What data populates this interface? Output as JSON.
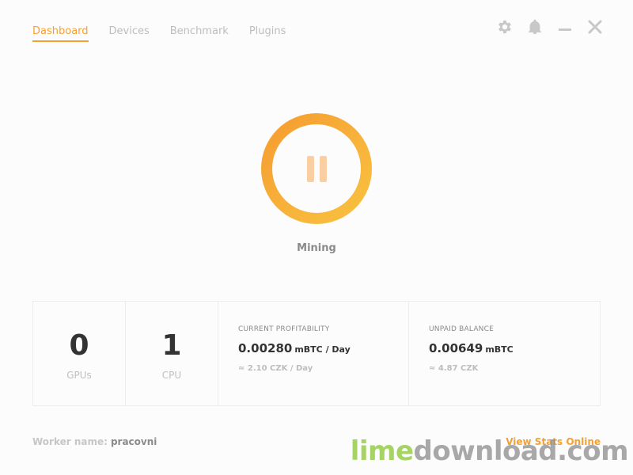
{
  "nav": {
    "tabs": [
      {
        "label": "Dashboard",
        "active": true
      },
      {
        "label": "Devices",
        "active": false
      },
      {
        "label": "Benchmark",
        "active": false
      },
      {
        "label": "Plugins",
        "active": false
      }
    ]
  },
  "window_controls": [
    "gear-icon",
    "bell-icon",
    "minimize-icon",
    "close-icon"
  ],
  "mining": {
    "status": "Mining",
    "button_icon": "pause-icon"
  },
  "stats": {
    "gpus": {
      "count": "0",
      "label": "GPUs"
    },
    "cpu": {
      "count": "1",
      "label": "CPU"
    },
    "profitability": {
      "title": "CURRENT PROFITABILITY",
      "value": "0.00280",
      "unit": "mBTC / Day",
      "fiat": "≈ 2.10 CZK / Day"
    },
    "balance": {
      "title": "UNPAID BALANCE",
      "value": "0.00649",
      "unit": "mBTC",
      "fiat": "≈ 4.87 CZK"
    }
  },
  "footer": {
    "worker_label": "Worker name:",
    "worker_name": "pracovni",
    "view_online": "View Stats Online"
  },
  "watermark": {
    "part1": "lime",
    "part2": "download.com"
  },
  "colors": {
    "accent": "#f5a033",
    "ring_start": "#f59a2e",
    "ring_end": "#f9c33f"
  }
}
